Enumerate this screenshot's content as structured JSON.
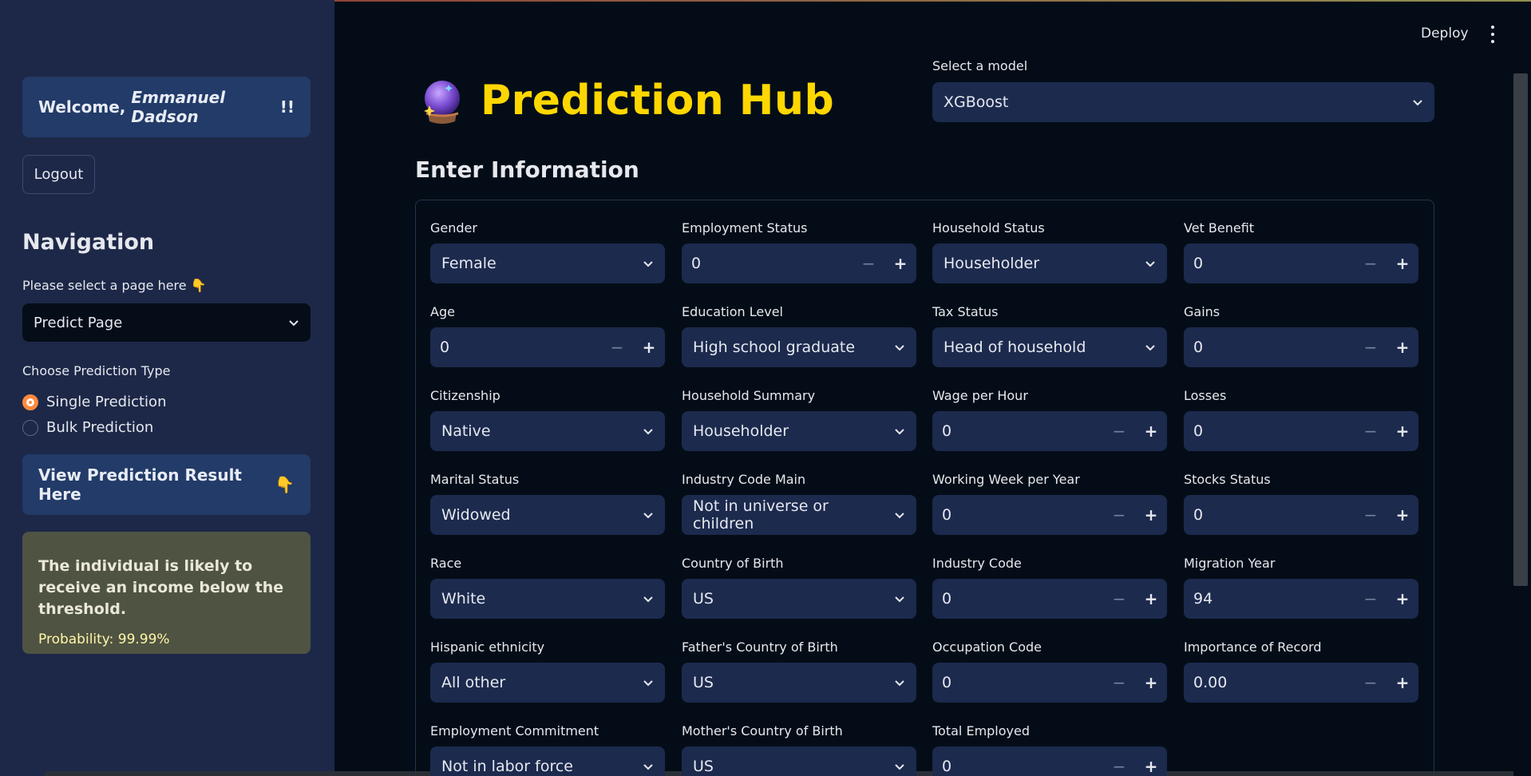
{
  "sidebar": {
    "welcome_prefix": "Welcome, ",
    "welcome_name": "Emmanuel Dadson",
    "welcome_suffix": "!!",
    "logout_label": "Logout",
    "nav_title": "Navigation",
    "nav_hint": "Please select a page here",
    "nav_hint_emoji": "👇",
    "page_select_value": "Predict Page",
    "prediction_type_label": "Choose Prediction Type",
    "prediction_types": [
      {
        "label": "Single Prediction",
        "selected": true
      },
      {
        "label": "Bulk Prediction",
        "selected": false
      }
    ],
    "view_result_label": "View Prediction Result Here",
    "view_result_emoji": "👇",
    "result_text": "The individual is likely to receive an income below the threshold.",
    "result_probability": "Probability: 99.99%"
  },
  "header": {
    "deploy_label": "Deploy",
    "title": "Prediction Hub",
    "model_label": "Select a model",
    "model_value": "XGBoost"
  },
  "form": {
    "section_title": "Enter Information",
    "fields": {
      "gender": {
        "label": "Gender",
        "value": "Female"
      },
      "employment_status": {
        "label": "Employment Status",
        "value": "0"
      },
      "household_status": {
        "label": "Household Status",
        "value": "Householder"
      },
      "vet_benefit": {
        "label": "Vet Benefit",
        "value": "0"
      },
      "age": {
        "label": "Age",
        "value": "0"
      },
      "education_level": {
        "label": "Education Level",
        "value": "High school graduate"
      },
      "tax_status": {
        "label": "Tax Status",
        "value": "Head of household"
      },
      "gains": {
        "label": "Gains",
        "value": "0"
      },
      "citizenship": {
        "label": "Citizenship",
        "value": "Native"
      },
      "household_summary": {
        "label": "Household Summary",
        "value": "Householder"
      },
      "wage_per_hour": {
        "label": "Wage per Hour",
        "value": "0"
      },
      "losses": {
        "label": "Losses",
        "value": "0"
      },
      "marital_status": {
        "label": "Marital Status",
        "value": "Widowed"
      },
      "industry_code_main": {
        "label": "Industry Code Main",
        "value": "Not in universe or children"
      },
      "working_week_per_year": {
        "label": "Working Week per Year",
        "value": "0"
      },
      "stocks_status": {
        "label": "Stocks Status",
        "value": "0"
      },
      "race": {
        "label": "Race",
        "value": "White"
      },
      "country_of_birth": {
        "label": "Country of Birth",
        "value": "US"
      },
      "industry_code": {
        "label": "Industry Code",
        "value": "0"
      },
      "migration_year": {
        "label": "Migration Year",
        "value": "94"
      },
      "hispanic_ethnicity": {
        "label": "Hispanic ethnicity",
        "value": "All other"
      },
      "fathers_country_of_birth": {
        "label": "Father's Country of Birth",
        "value": "US"
      },
      "occupation_code": {
        "label": "Occupation Code",
        "value": "0"
      },
      "importance_of_record": {
        "label": "Importance of Record",
        "value": "0.00"
      },
      "employment_commitment": {
        "label": "Employment Commitment",
        "value": "Not in labor force"
      },
      "mothers_country_of_birth": {
        "label": "Mother's Country of Birth",
        "value": "US"
      },
      "total_employed": {
        "label": "Total Employed",
        "value": "0"
      }
    },
    "minus_symbol": "−",
    "plus_symbol": "+"
  },
  "colors": {
    "sidebar_bg": "#1d2848",
    "main_bg": "#040d17",
    "title_accent": "#ffd700",
    "radio_accent": "#ff8a3d",
    "input_bg": "#1c2a4e"
  }
}
